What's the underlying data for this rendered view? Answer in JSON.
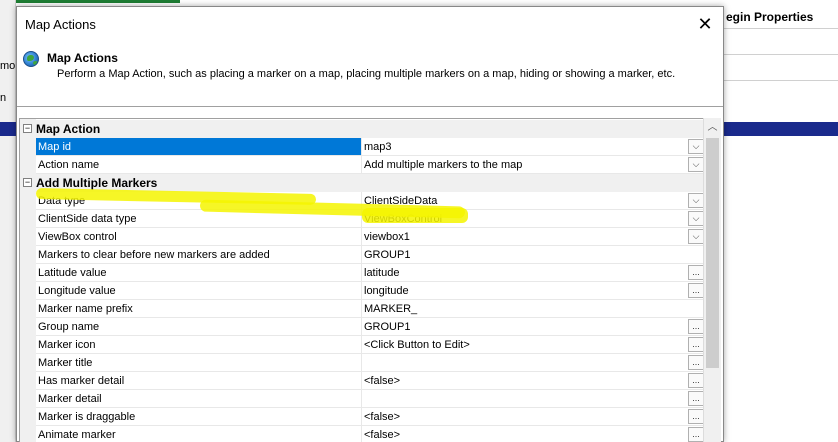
{
  "background": {
    "left_text_1": "mo",
    "left_text_2": "n",
    "plugin_title": "egin Properties"
  },
  "dialog": {
    "title": "Map Actions",
    "close_glyph": "✕",
    "header": {
      "icon": "globe-icon",
      "title": "Map Actions",
      "description": "Perform a Map Action, such as placing a marker on a map, placing multiple markers on a map, hiding or showing a marker, etc."
    }
  },
  "grid": {
    "categories": [
      {
        "label": "Map Action",
        "toggle": "−",
        "rows": [
          {
            "name": "Map id",
            "value": "map3",
            "button": "dropdown"
          },
          {
            "name": "Action name",
            "value": "Add multiple markers to the map",
            "button": "dropdown"
          }
        ]
      },
      {
        "label": "Add Multiple Markers",
        "toggle": "−",
        "rows": [
          {
            "name": "Data type",
            "value": "ClientSideData",
            "button": "dropdown"
          },
          {
            "name": "ClientSide data type",
            "value": "ViewBoxControl",
            "button": "dropdown"
          },
          {
            "name": "ViewBox control",
            "value": "viewbox1",
            "button": "dropdown"
          },
          {
            "name": "Markers to clear before new markers are added",
            "value": "GROUP1",
            "button": "none"
          },
          {
            "name": "Latitude value",
            "value": "latitude",
            "button": "ellipsis"
          },
          {
            "name": "Longitude value",
            "value": "longitude",
            "button": "ellipsis"
          },
          {
            "name": "Marker name prefix",
            "value": "MARKER_",
            "button": "none"
          },
          {
            "name": "Group name",
            "value": "GROUP1",
            "button": "ellipsis"
          },
          {
            "name": "Marker icon",
            "value": "<Click Button to Edit>",
            "button": "ellipsis"
          },
          {
            "name": "Marker title",
            "value": "",
            "button": "ellipsis"
          },
          {
            "name": "Has marker detail",
            "value": "<false>",
            "button": "ellipsis"
          },
          {
            "name": "Marker detail",
            "value": "",
            "button": "ellipsis"
          },
          {
            "name": "Marker is draggable",
            "value": "<false>",
            "button": "ellipsis"
          },
          {
            "name": "Animate marker",
            "value": "<false>",
            "button": "ellipsis"
          }
        ]
      }
    ],
    "selected_row": "Map id",
    "button_glyphs": {
      "dropdown": "⌵",
      "ellipsis": "..."
    },
    "scroll_up_glyph": "︿"
  },
  "colors": {
    "selection": "#0078d7",
    "highlighter": "#f5f500",
    "background_band": "#1a2a8c"
  }
}
